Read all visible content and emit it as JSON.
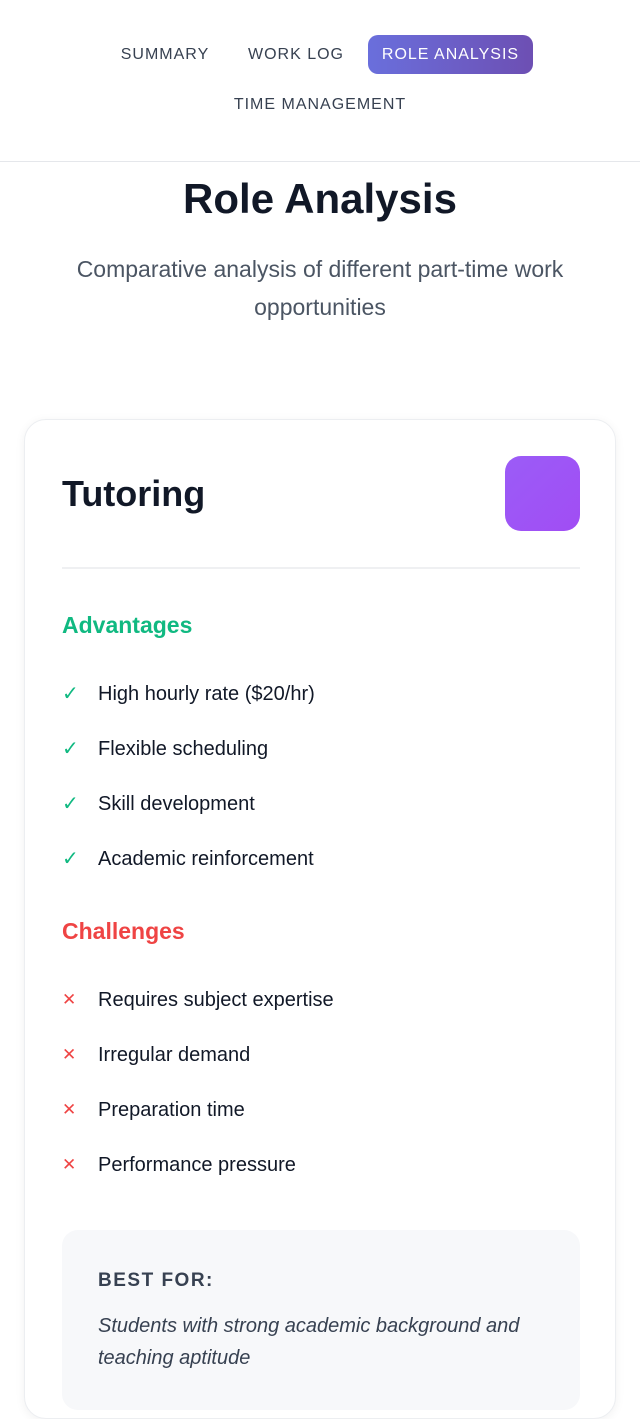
{
  "nav": {
    "tabs": [
      {
        "label": "SUMMARY",
        "active": false
      },
      {
        "label": "WORK LOG",
        "active": false
      },
      {
        "label": "ROLE ANALYSIS",
        "active": true
      },
      {
        "label": "TIME MANAGEMENT",
        "active": false
      }
    ],
    "active_gradient": [
      "#6a6fdc",
      "#6d4fb3"
    ]
  },
  "header": {
    "title": "Role Analysis",
    "subtitle": "Comparative analysis of different part-time work opportunities"
  },
  "role_card": {
    "title": "Tutoring",
    "icon_color": "#9b5cf7",
    "advantages": {
      "heading": "Advantages",
      "color": "#10b981",
      "icon": "check-icon",
      "items": [
        "High hourly rate ($20/hr)",
        "Flexible scheduling",
        "Skill development",
        "Academic reinforcement"
      ]
    },
    "challenges": {
      "heading": "Challenges",
      "color": "#ef4444",
      "icon": "cross-icon",
      "items": [
        "Requires subject expertise",
        "Irregular demand",
        "Preparation time",
        "Performance pressure"
      ]
    },
    "best_for": {
      "label": "BEST FOR:",
      "text": "Students with strong academic background and teaching aptitude"
    }
  }
}
